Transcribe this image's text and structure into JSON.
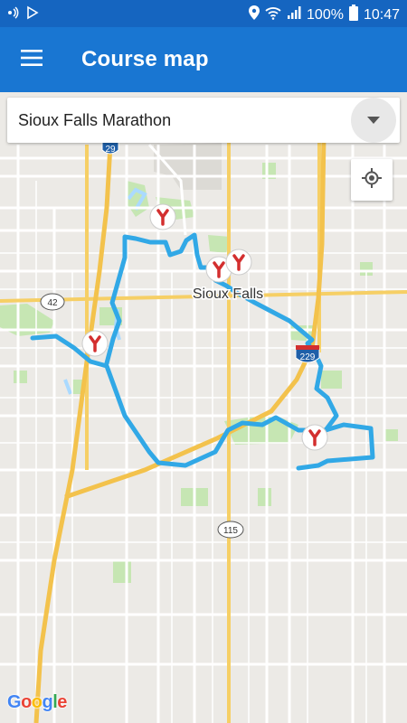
{
  "status_bar": {
    "battery": "100%",
    "time": "10:47"
  },
  "app_bar": {
    "title": "Course map"
  },
  "race_selector": {
    "selected": "Sioux Falls Marathon"
  },
  "map": {
    "city_label": "Sioux Falls",
    "route_color": "#31a8e6",
    "marker_color": "#d32f2f",
    "highway_shields": [
      "29",
      "42",
      "229",
      "115"
    ]
  },
  "attribution": {
    "logo_text": "Google",
    "logo_colors": [
      "#4285f4",
      "#ea4335",
      "#fbbc05",
      "#4285f4",
      "#34a853",
      "#ea4335"
    ]
  },
  "icons": {
    "status_left": [
      "hotspot-icon",
      "play-store-icon"
    ],
    "status_right": [
      "location-icon",
      "wifi-icon",
      "signal-icon",
      "battery-icon"
    ],
    "app_bar": "menu-icon",
    "selector": "dropdown-arrow-icon",
    "map_control": "my-location-icon"
  }
}
